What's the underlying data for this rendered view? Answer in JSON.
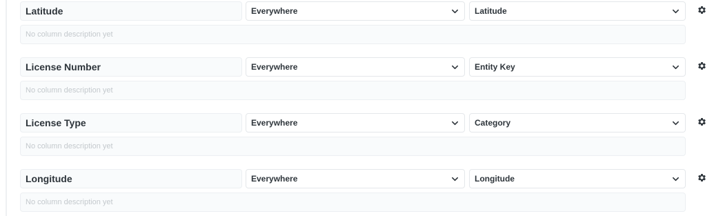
{
  "columns": [
    {
      "name": "Latitude",
      "visibility": "Everywhere",
      "semantic_type": "Latitude",
      "description_value": "",
      "description_placeholder": "No column description yet"
    },
    {
      "name": "License Number",
      "visibility": "Everywhere",
      "semantic_type": "Entity Key",
      "description_value": "",
      "description_placeholder": "No column description yet"
    },
    {
      "name": "License Type",
      "visibility": "Everywhere",
      "semantic_type": "Category",
      "description_value": "",
      "description_placeholder": "No column description yet"
    },
    {
      "name": "Longitude",
      "visibility": "Everywhere",
      "semantic_type": "Longitude",
      "description_value": "",
      "description_placeholder": "No column description yet"
    }
  ],
  "icons": {
    "select_chevron": "chevron-down-icon",
    "settings": "gear-icon"
  }
}
